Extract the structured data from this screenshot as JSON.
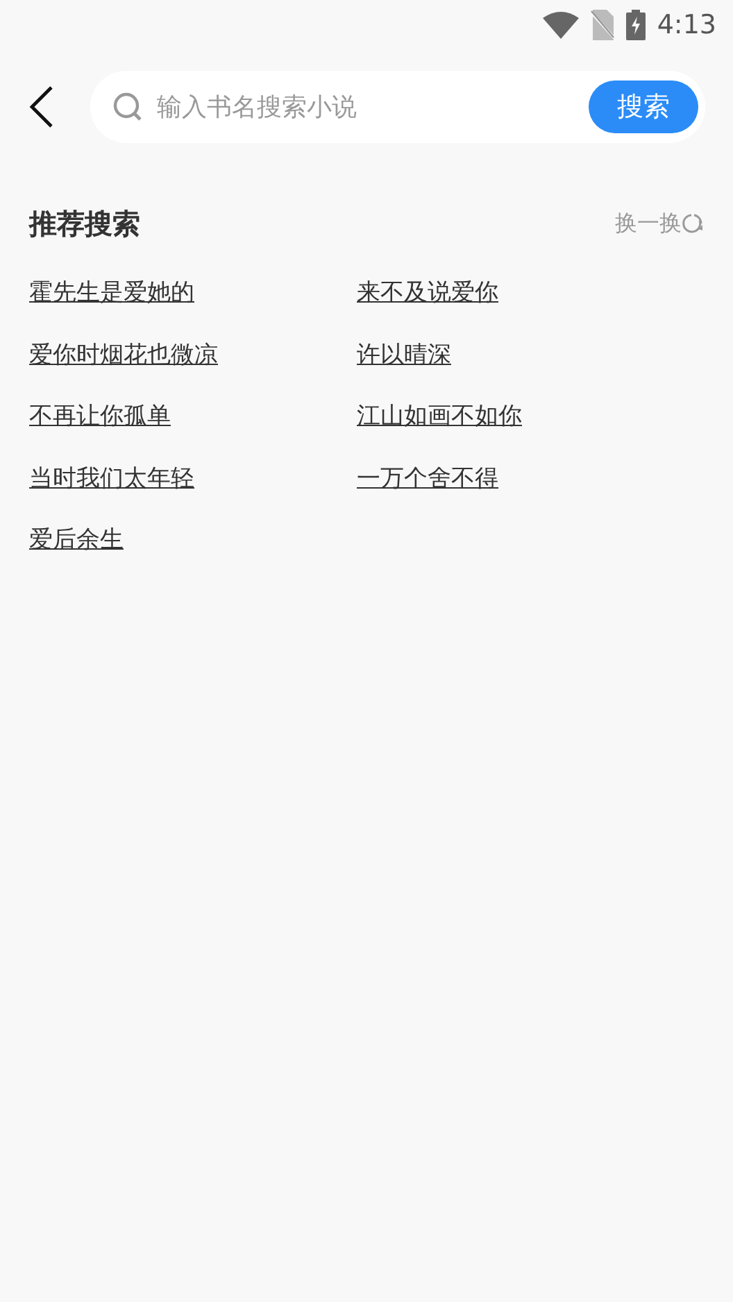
{
  "status_bar": {
    "time": "4:13"
  },
  "search": {
    "placeholder": "输入书名搜索小说",
    "button": "搜索"
  },
  "recommend": {
    "title": "推荐搜索",
    "refresh": "换一换",
    "items": [
      "霍先生是爱她的",
      "来不及说爱你",
      "爱你时烟花也微凉",
      "许以晴深",
      "不再让你孤单",
      "江山如画不如你",
      "当时我们太年轻",
      "一万个舍不得",
      "爱后余生"
    ]
  }
}
